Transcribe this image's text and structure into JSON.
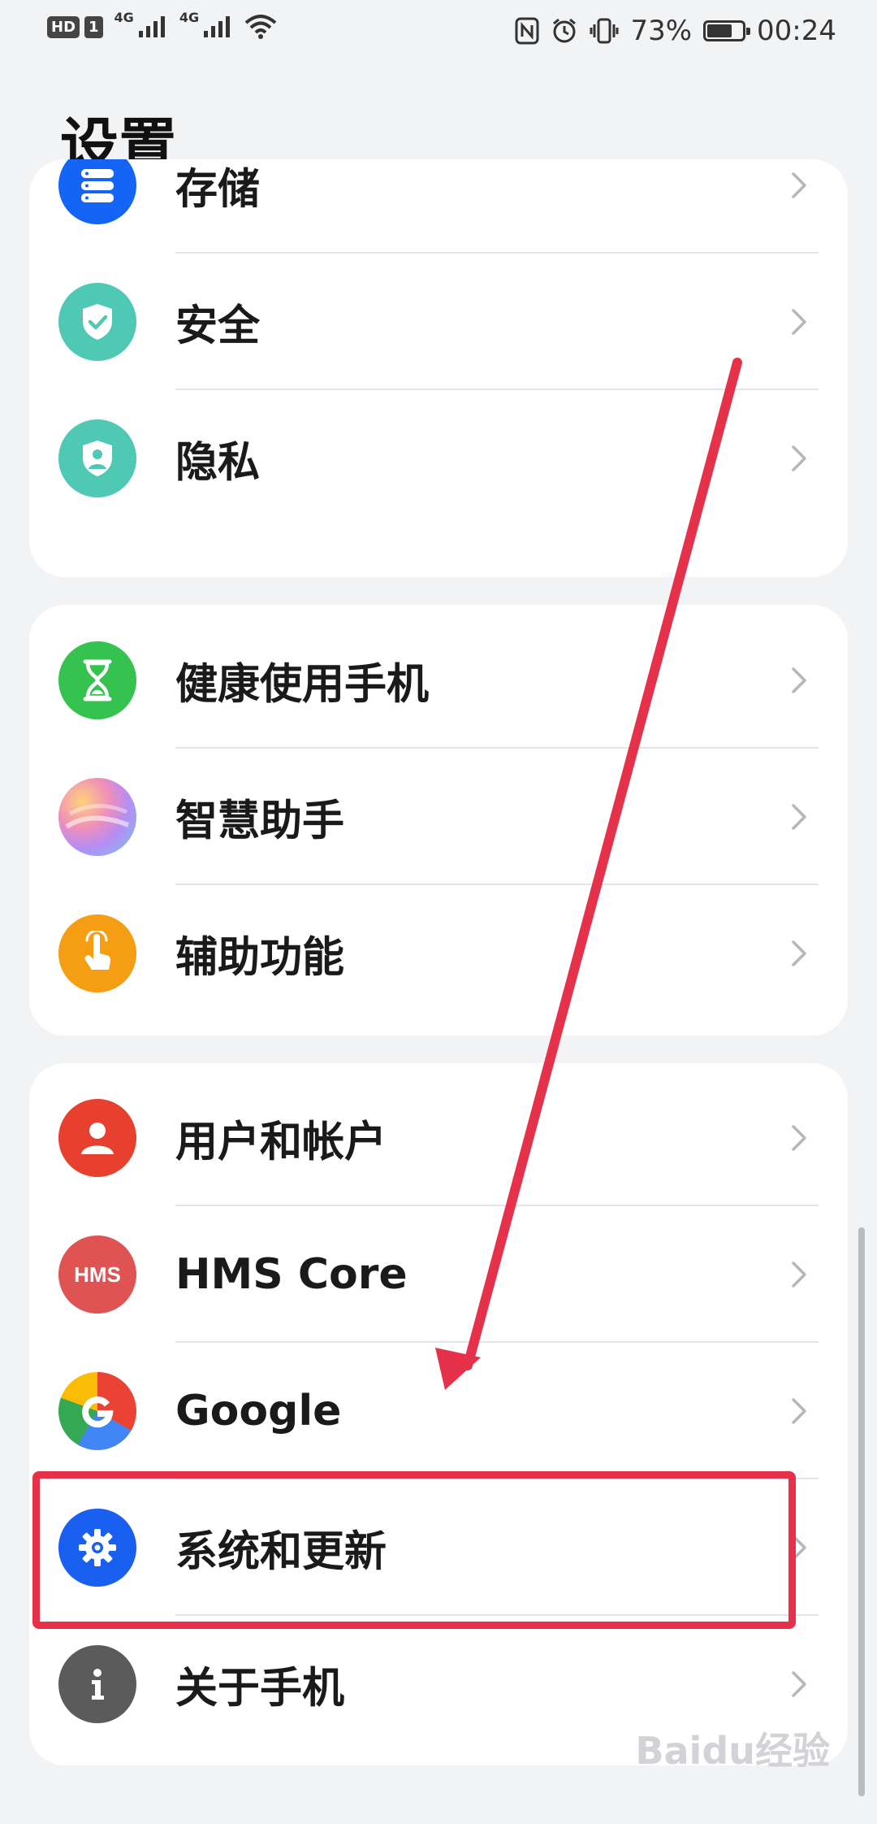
{
  "status_bar": {
    "hd": "HD",
    "sim": "1",
    "network1": "4G",
    "network2": "4G",
    "battery_percent": "73%",
    "battery_level": 0.73,
    "time": "00:24"
  },
  "page": {
    "title": "设置"
  },
  "groups": [
    {
      "items": [
        {
          "label": "存储",
          "icon": "storage-icon",
          "color": "#1464f6"
        },
        {
          "label": "安全",
          "icon": "shield-check-icon",
          "color": "#4fc9b4"
        },
        {
          "label": "隐私",
          "icon": "privacy-shield-icon",
          "color": "#4fc9b4"
        }
      ]
    },
    {
      "items": [
        {
          "label": "健康使用手机",
          "icon": "hourglass-icon",
          "color": "#36c24f"
        },
        {
          "label": "智慧助手",
          "icon": "smart-assistant-icon",
          "color": "#d58de0"
        },
        {
          "label": "辅助功能",
          "icon": "touch-hand-icon",
          "color": "#f59e14"
        }
      ]
    },
    {
      "items": [
        {
          "label": "用户和帐户",
          "icon": "user-icon",
          "color": "#e8402f"
        },
        {
          "label": "HMS Core",
          "icon": "hms-icon",
          "color": "#e05353"
        },
        {
          "label": "Google",
          "icon": "google-icon",
          "color": "#4285f4"
        },
        {
          "label": "系统和更新",
          "icon": "gear-icon",
          "color": "#1a60f0"
        },
        {
          "label": "关于手机",
          "icon": "info-icon",
          "color": "#5b5b5b"
        }
      ]
    }
  ],
  "hms_icon_text": "HMS",
  "watermark": "Baidu经验",
  "annotation_color": "#e6314a"
}
